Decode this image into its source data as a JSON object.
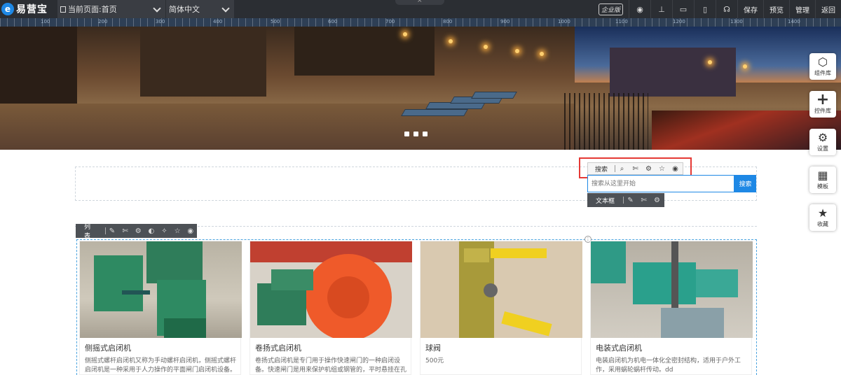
{
  "app": {
    "logo_mark": "e",
    "logo_text": "易营宝"
  },
  "toolbar": {
    "current_page": "当前页面:首页",
    "language": "简体中文",
    "center_tab": "×",
    "edition_badge": "企业版",
    "save_label": "保存",
    "preview_label": "预览",
    "manage_label": "管理",
    "back_label": "返回"
  },
  "ruler": {
    "ticks": [
      "100",
      "200",
      "300",
      "400",
      "500",
      "600",
      "700",
      "800",
      "900",
      "1000",
      "1100",
      "1200",
      "1300",
      "1400"
    ]
  },
  "side_panel": {
    "items": [
      {
        "label": "组件库",
        "icon": "cube-icon"
      },
      {
        "label": "控件库",
        "icon": "plus-icon"
      },
      {
        "label": "设置",
        "icon": "gear-icon"
      },
      {
        "label": "模板",
        "icon": "grid-icon"
      },
      {
        "label": "收藏",
        "icon": "star-icon"
      }
    ]
  },
  "search_module": {
    "toolbar_label": "搜索",
    "input_placeholder": "搜索从这里开始",
    "button_label": "搜索",
    "textbox_toolbar_label": "文本框"
  },
  "list_module": {
    "toolbar_label": "列表",
    "products": [
      {
        "title": "侧摇式启闭机",
        "desc": "侧摇式螺杆启闭机又称为手动螺杆启闭机，侧摇式螺杆启闭机是一种采用于人力操作的平面闸门启闭机设备。"
      },
      {
        "title": "卷扬式启闭机",
        "desc": "卷扬式启闭机是专门用于操作快速闸门的一种启闭设备。快速闸门是用来保护机组或钢管的，平时悬挂在孔口上..."
      },
      {
        "title": "球阀",
        "desc": "500元"
      },
      {
        "title": "电装式启闭机",
        "desc": "电装启闭机为机电一体化全密封结构，适用于户外工作，采用蜗轮蜗杆传动。dd"
      }
    ]
  },
  "colors": {
    "accent": "#1e88e5",
    "highlight": "#e53935",
    "toolbar_bg": "#2b2e33"
  }
}
